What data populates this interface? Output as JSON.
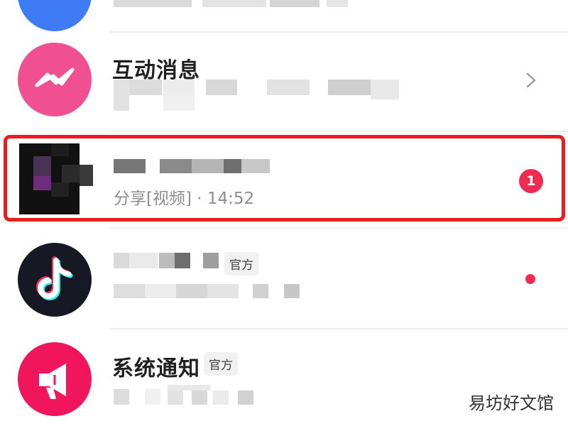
{
  "conversations": [
    {
      "title": "",
      "official_badge": "",
      "subtitle": "",
      "avatar_color": "#3d7cf5",
      "has_chevron": false
    },
    {
      "title": "互动消息",
      "official_badge": "",
      "subtitle": "",
      "avatar_color": "#f0508f",
      "avatar_icon": "activity-wave-icon",
      "has_chevron": true
    },
    {
      "title": "",
      "official_badge": "",
      "subtitle": "分享[视频] · 14:52",
      "avatar_color": "#111111",
      "unread_count": "1",
      "highlighted": true,
      "highlight_color": "#ec1c1c"
    },
    {
      "title": "",
      "official_badge": "官方",
      "subtitle": "",
      "avatar_color": "#161823",
      "avatar_icon": "tiktok-note-icon",
      "unread_dot": true
    },
    {
      "title": "系统通知",
      "official_badge": "官方",
      "subtitle": "",
      "avatar_color": "#f0155d",
      "avatar_icon": "megaphone-icon"
    }
  ],
  "accent_color": "#ef2b52",
  "watermark": "易坊好文馆"
}
